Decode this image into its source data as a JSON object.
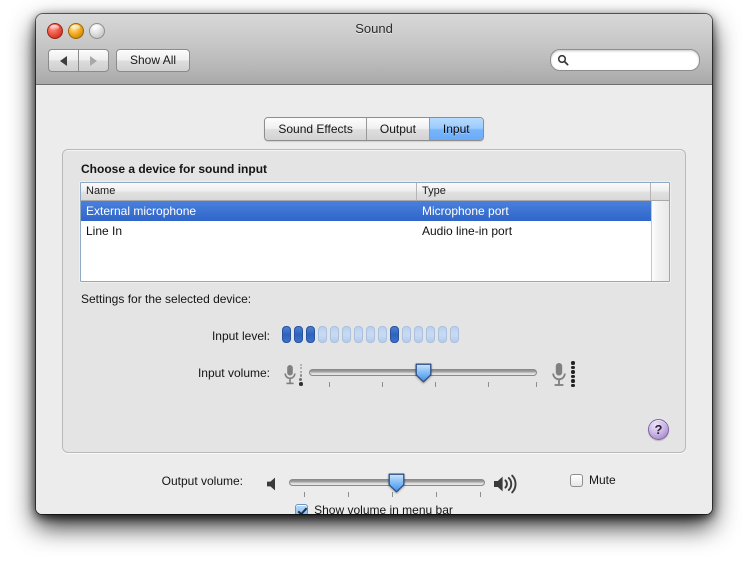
{
  "window": {
    "title": "Sound",
    "traffic_lights": [
      "close",
      "minimize",
      "zoom"
    ]
  },
  "toolbar": {
    "back_label": "",
    "forward_label": "",
    "show_all_label": "Show All",
    "search_placeholder": "",
    "search_value": "",
    "search_icon": "search-icon"
  },
  "tabs": [
    {
      "label": "Sound Effects",
      "selected": false
    },
    {
      "label": "Output",
      "selected": false
    },
    {
      "label": "Input",
      "selected": true
    }
  ],
  "panel": {
    "choose_label": "Choose a device for sound input",
    "settings_label": "Settings for the selected device:",
    "help_label": "?"
  },
  "device_table": {
    "columns": [
      "Name",
      "Type"
    ],
    "rows": [
      {
        "name": "External microphone",
        "type": "Microphone port",
        "selected": true
      },
      {
        "name": "Line In",
        "type": "Audio line-in port",
        "selected": false
      }
    ]
  },
  "input_level": {
    "label": "Input level:",
    "segments_total": 15,
    "segments_lit": [
      1,
      2,
      3,
      10
    ],
    "lit_color": "#2f62bd",
    "unlit_color": "#c2d5f0"
  },
  "input_volume": {
    "label": "Input volume:",
    "value_percent": 50,
    "ticks": 5,
    "left_icon": "microphone-small-icon",
    "right_icon": "microphone-large-icon"
  },
  "output_volume": {
    "label": "Output volume:",
    "value_percent": 55,
    "ticks": 5,
    "left_icon": "speaker-quiet-icon",
    "right_icon": "speaker-loud-icon",
    "mute_label": "Mute",
    "mute_checked": false
  },
  "show_volume": {
    "label": "Show volume in menu bar",
    "checked": true
  },
  "colors": {
    "selection_blue": "#3b72d1",
    "tab_selected_blue": "#8cc0fb",
    "help_purple": "#a78ccd"
  }
}
